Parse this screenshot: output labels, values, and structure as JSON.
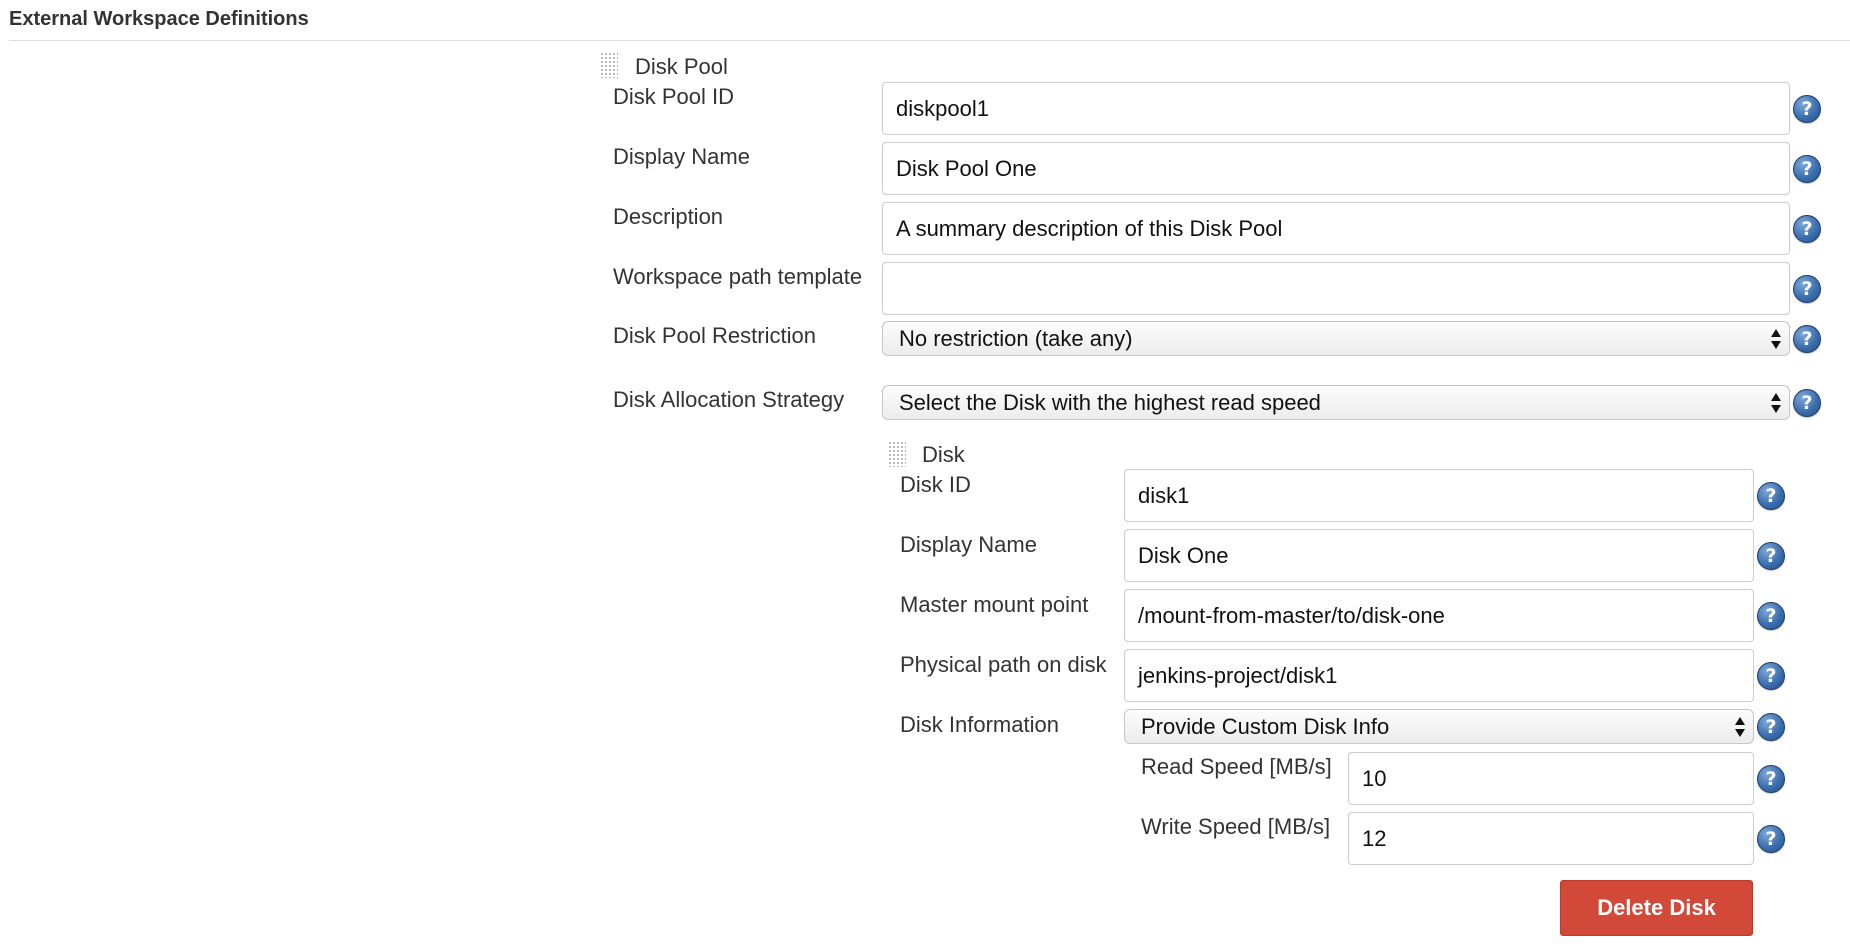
{
  "section": {
    "title": "External Workspace Definitions"
  },
  "disk_pool": {
    "header": "Disk Pool",
    "fields": {
      "id": {
        "label": "Disk Pool ID",
        "value": "diskpool1"
      },
      "display_name": {
        "label": "Display Name",
        "value": "Disk Pool One"
      },
      "description": {
        "label": "Description",
        "value": "A summary description of this Disk Pool"
      },
      "workspace_path_template": {
        "label": "Workspace path template",
        "value": ""
      },
      "restriction": {
        "label": "Disk Pool Restriction",
        "selected": "No restriction (take any)"
      },
      "allocation_strategy": {
        "label": "Disk Allocation Strategy",
        "selected": "Select the Disk with the highest read speed"
      }
    }
  },
  "disk": {
    "header": "Disk",
    "fields": {
      "id": {
        "label": "Disk ID",
        "value": "disk1"
      },
      "display_name": {
        "label": "Display Name",
        "value": "Disk One"
      },
      "master_mount_point": {
        "label": "Master mount point",
        "value": "/mount-from-master/to/disk-one"
      },
      "physical_path": {
        "label": "Physical path on disk",
        "value": "jenkins-project/disk1"
      },
      "disk_information": {
        "label": "Disk Information",
        "selected": "Provide Custom Disk Info"
      },
      "read_speed": {
        "label": "Read Speed [MB/s]",
        "value": "10"
      },
      "write_speed": {
        "label": "Write Speed [MB/s]",
        "value": "12"
      }
    },
    "delete_label": "Delete Disk"
  },
  "help_glyph": "?",
  "icons": {
    "help": "help-icon",
    "drag": "drag-handle-icon"
  },
  "colors": {
    "danger": "#d24939",
    "help": "#3b6fae"
  }
}
